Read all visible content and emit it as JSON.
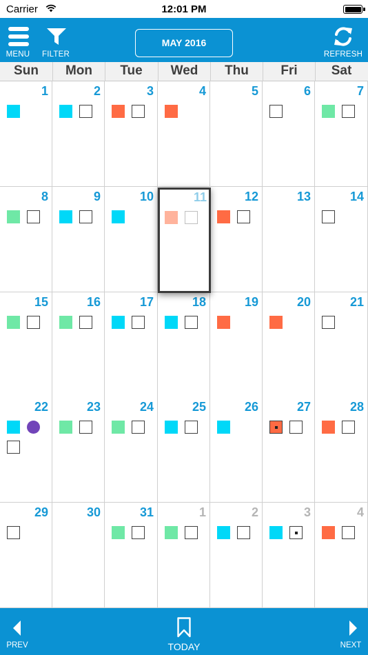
{
  "status": {
    "carrier": "Carrier",
    "time": "12:01 PM"
  },
  "toolbar": {
    "menu_label": "MENU",
    "filter_label": "FILTER",
    "month_label": "MAY 2016",
    "refresh_label": "REFRESH"
  },
  "weekdays": [
    "Sun",
    "Mon",
    "Tue",
    "Wed",
    "Thu",
    "Fri",
    "Sat"
  ],
  "colors": {
    "brand_blue": "#0b92d3",
    "day_number": "#1699d6",
    "cyan": "#00d8f8",
    "green": "#6fe8a6",
    "orange": "#ff6b44",
    "purple": "#7144b9"
  },
  "weeks": [
    [
      {
        "day": "1",
        "marks": [
          "cyan"
        ]
      },
      {
        "day": "2",
        "marks": [
          "cyan",
          "empty"
        ]
      },
      {
        "day": "3",
        "marks": [
          "orange",
          "empty"
        ]
      },
      {
        "day": "4",
        "marks": [
          "orange"
        ]
      },
      {
        "day": "5",
        "marks": []
      },
      {
        "day": "6",
        "marks": [
          "empty"
        ]
      },
      {
        "day": "7",
        "marks": [
          "green",
          "empty"
        ]
      }
    ],
    [
      {
        "day": "8",
        "marks": [
          "green",
          "empty"
        ]
      },
      {
        "day": "9",
        "marks": [
          "cyan",
          "empty"
        ]
      },
      {
        "day": "10",
        "marks": [
          "cyan"
        ]
      },
      {
        "day": "11",
        "today": true,
        "marks": [
          "salmon",
          "empty-light"
        ]
      },
      {
        "day": "12",
        "marks": [
          "orange",
          "empty"
        ]
      },
      {
        "day": "13",
        "marks": []
      },
      {
        "day": "14",
        "marks": [
          "empty"
        ]
      }
    ],
    [
      {
        "day": "15",
        "marks": [
          "green",
          "empty"
        ]
      },
      {
        "day": "16",
        "marks": [
          "green",
          "empty"
        ]
      },
      {
        "day": "17",
        "marks": [
          "cyan",
          "empty"
        ]
      },
      {
        "day": "18",
        "marks": [
          "cyan",
          "empty"
        ]
      },
      {
        "day": "19",
        "marks": [
          "orange"
        ]
      },
      {
        "day": "20",
        "marks": [
          "orange"
        ]
      },
      {
        "day": "21",
        "marks": [
          "empty"
        ]
      }
    ],
    [
      {
        "day": "22",
        "marks": [
          "cyan",
          "purple",
          "empty"
        ]
      },
      {
        "day": "23",
        "marks": [
          "green",
          "empty"
        ]
      },
      {
        "day": "24",
        "marks": [
          "green",
          "empty"
        ]
      },
      {
        "day": "25",
        "marks": [
          "cyan",
          "empty"
        ]
      },
      {
        "day": "26",
        "marks": [
          "cyan"
        ]
      },
      {
        "day": "27",
        "marks": [
          "orange-dot",
          "empty"
        ]
      },
      {
        "day": "28",
        "marks": [
          "orange",
          "empty"
        ]
      }
    ],
    [
      {
        "day": "29",
        "marks": [
          "empty"
        ]
      },
      {
        "day": "30",
        "marks": []
      },
      {
        "day": "31",
        "marks": [
          "green",
          "empty"
        ]
      },
      {
        "day": "1",
        "other": true,
        "marks": [
          "green",
          "empty"
        ]
      },
      {
        "day": "2",
        "other": true,
        "marks": [
          "cyan",
          "empty"
        ]
      },
      {
        "day": "3",
        "other": true,
        "marks": [
          "cyan",
          "empty-dot"
        ]
      },
      {
        "day": "4",
        "other": true,
        "marks": [
          "orange",
          "empty"
        ]
      }
    ]
  ],
  "bottom": {
    "prev_label": "PREV",
    "today_label": "TODAY",
    "next_label": "NEXT"
  }
}
